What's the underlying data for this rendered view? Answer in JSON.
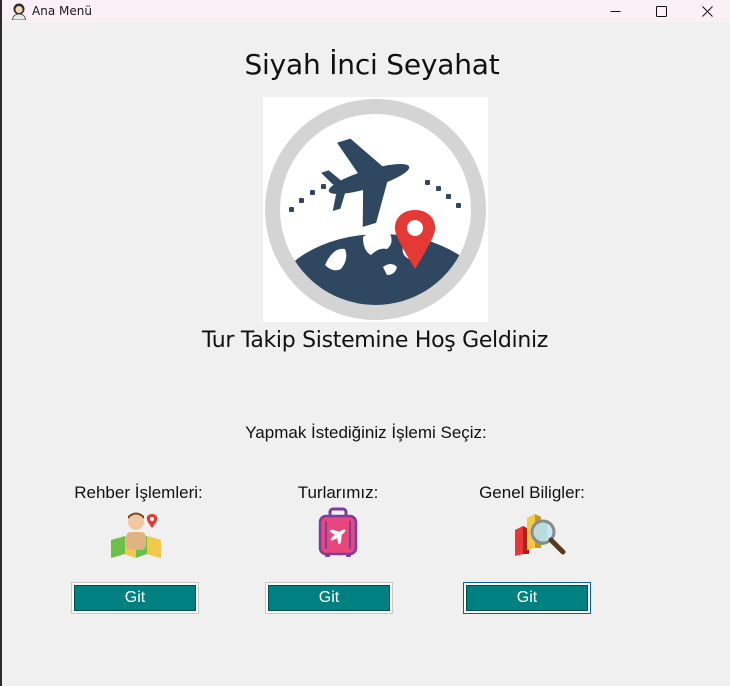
{
  "window": {
    "title": "Ana Menü",
    "icon": "user-avatar-icon"
  },
  "main": {
    "heading": "Siyah İnci Seyahat",
    "logo": "travel-logo-plane-globe-pin",
    "welcome": "Tur Takip Sistemine Hoş Geldiniz",
    "prompt": "Yapmak İstediğiniz İşlemi Seçiz:"
  },
  "options": [
    {
      "label": "Rehber İşlemleri:",
      "icon": "guide-map-icon",
      "button": "Git"
    },
    {
      "label": "Turlarımız:",
      "icon": "luggage-icon",
      "button": "Git"
    },
    {
      "label": "Genel Biligler:",
      "icon": "analytics-magnifier-icon",
      "button": "Git"
    }
  ],
  "colors": {
    "button_fill": "#008080",
    "logo_navy": "#2f4760",
    "pin_red": "#e53935",
    "ring_gray": "#d4d4d4"
  }
}
